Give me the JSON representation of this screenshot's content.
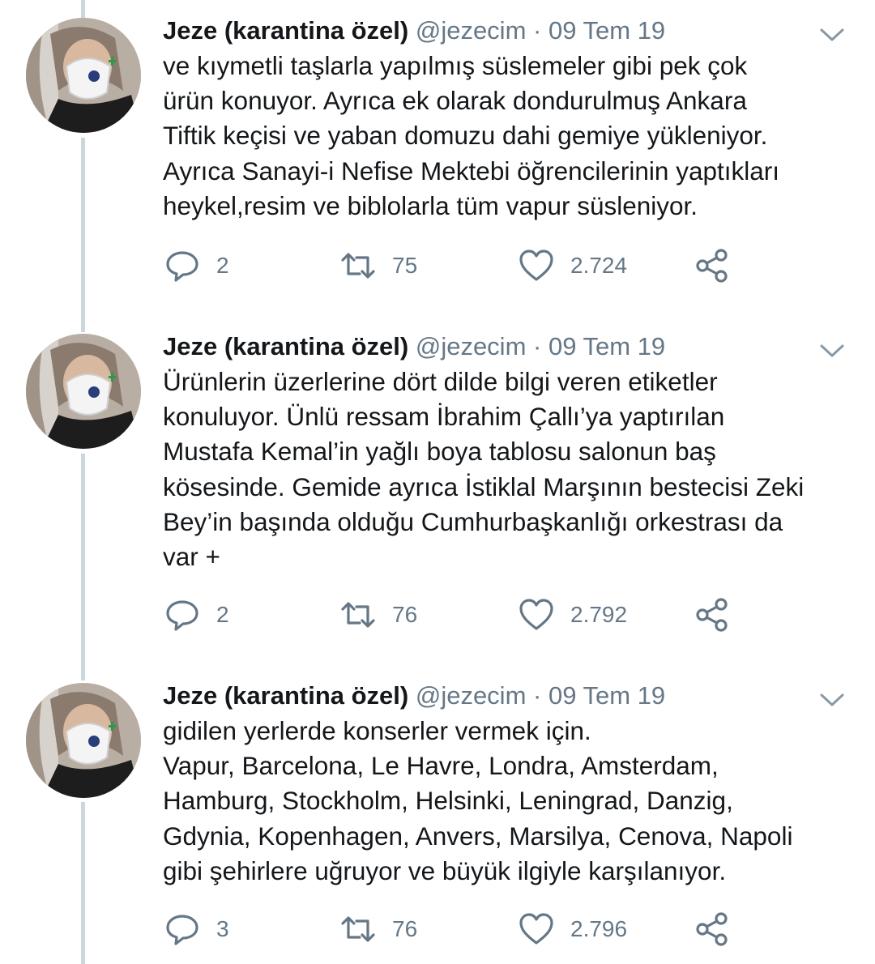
{
  "colors": {
    "text": "#14171a",
    "muted": "#657786",
    "thread_line": "#ccd6dd",
    "background": "#ffffff"
  },
  "icons": {
    "reply": "reply-icon",
    "retweet": "retweet-icon",
    "like": "like-icon",
    "share": "share-icon",
    "menu": "chevron-down-icon"
  },
  "tweets": [
    {
      "author_name": "Jeze (karantina özel)",
      "handle": "@jezecim",
      "separator": "·",
      "date": "09 Tem 19",
      "text": "ve kıymetli taşlarla yapılmış süslemeler gibi pek çok\nürün konuyor. Ayrıca ek olarak dondurulmuş Ankara\nTiftik keçisi ve yaban domuzu dahi gemiye yükleniyor.\nAyrıca Sanayi-i Nefise Mektebi öğrencilerinin yaptıkları\nheykel,resim ve biblolarla tüm vapur süsleniyor.",
      "replies": "2",
      "retweets": "75",
      "likes": "2.724"
    },
    {
      "author_name": "Jeze (karantina özel)",
      "handle": "@jezecim",
      "separator": "·",
      "date": "09 Tem 19",
      "text": "Ürünlerin üzerlerine dört dilde bilgi veren etiketler\nkonuluyor. Ünlü ressam İbrahim Çallı’ya yaptırılan\nMustafa Kemal’in yağlı boya tablosu salonun baş\nkösesinde. Gemide ayrıca İstiklal Marşının bestecisi Zeki\nBey’in başında olduğu Cumhurbaşkanlığı orkestrası da\nvar +",
      "replies": "2",
      "retweets": "76",
      "likes": "2.792"
    },
    {
      "author_name": "Jeze (karantina özel)",
      "handle": "@jezecim",
      "separator": "·",
      "date": "09 Tem 19",
      "text": "gidilen yerlerde konserler vermek için.\nVapur, Barcelona, Le Havre, Londra, Amsterdam,\nHamburg, Stockholm, Helsinki, Leningrad, Danzig,\nGdynia, Kopenhagen, Anvers, Marsilya, Cenova, Napoli\ngibi şehirlere uğruyor ve büyük ilgiyle karşılanıyor.",
      "replies": "3",
      "retweets": "76",
      "likes": "2.796"
    }
  ]
}
